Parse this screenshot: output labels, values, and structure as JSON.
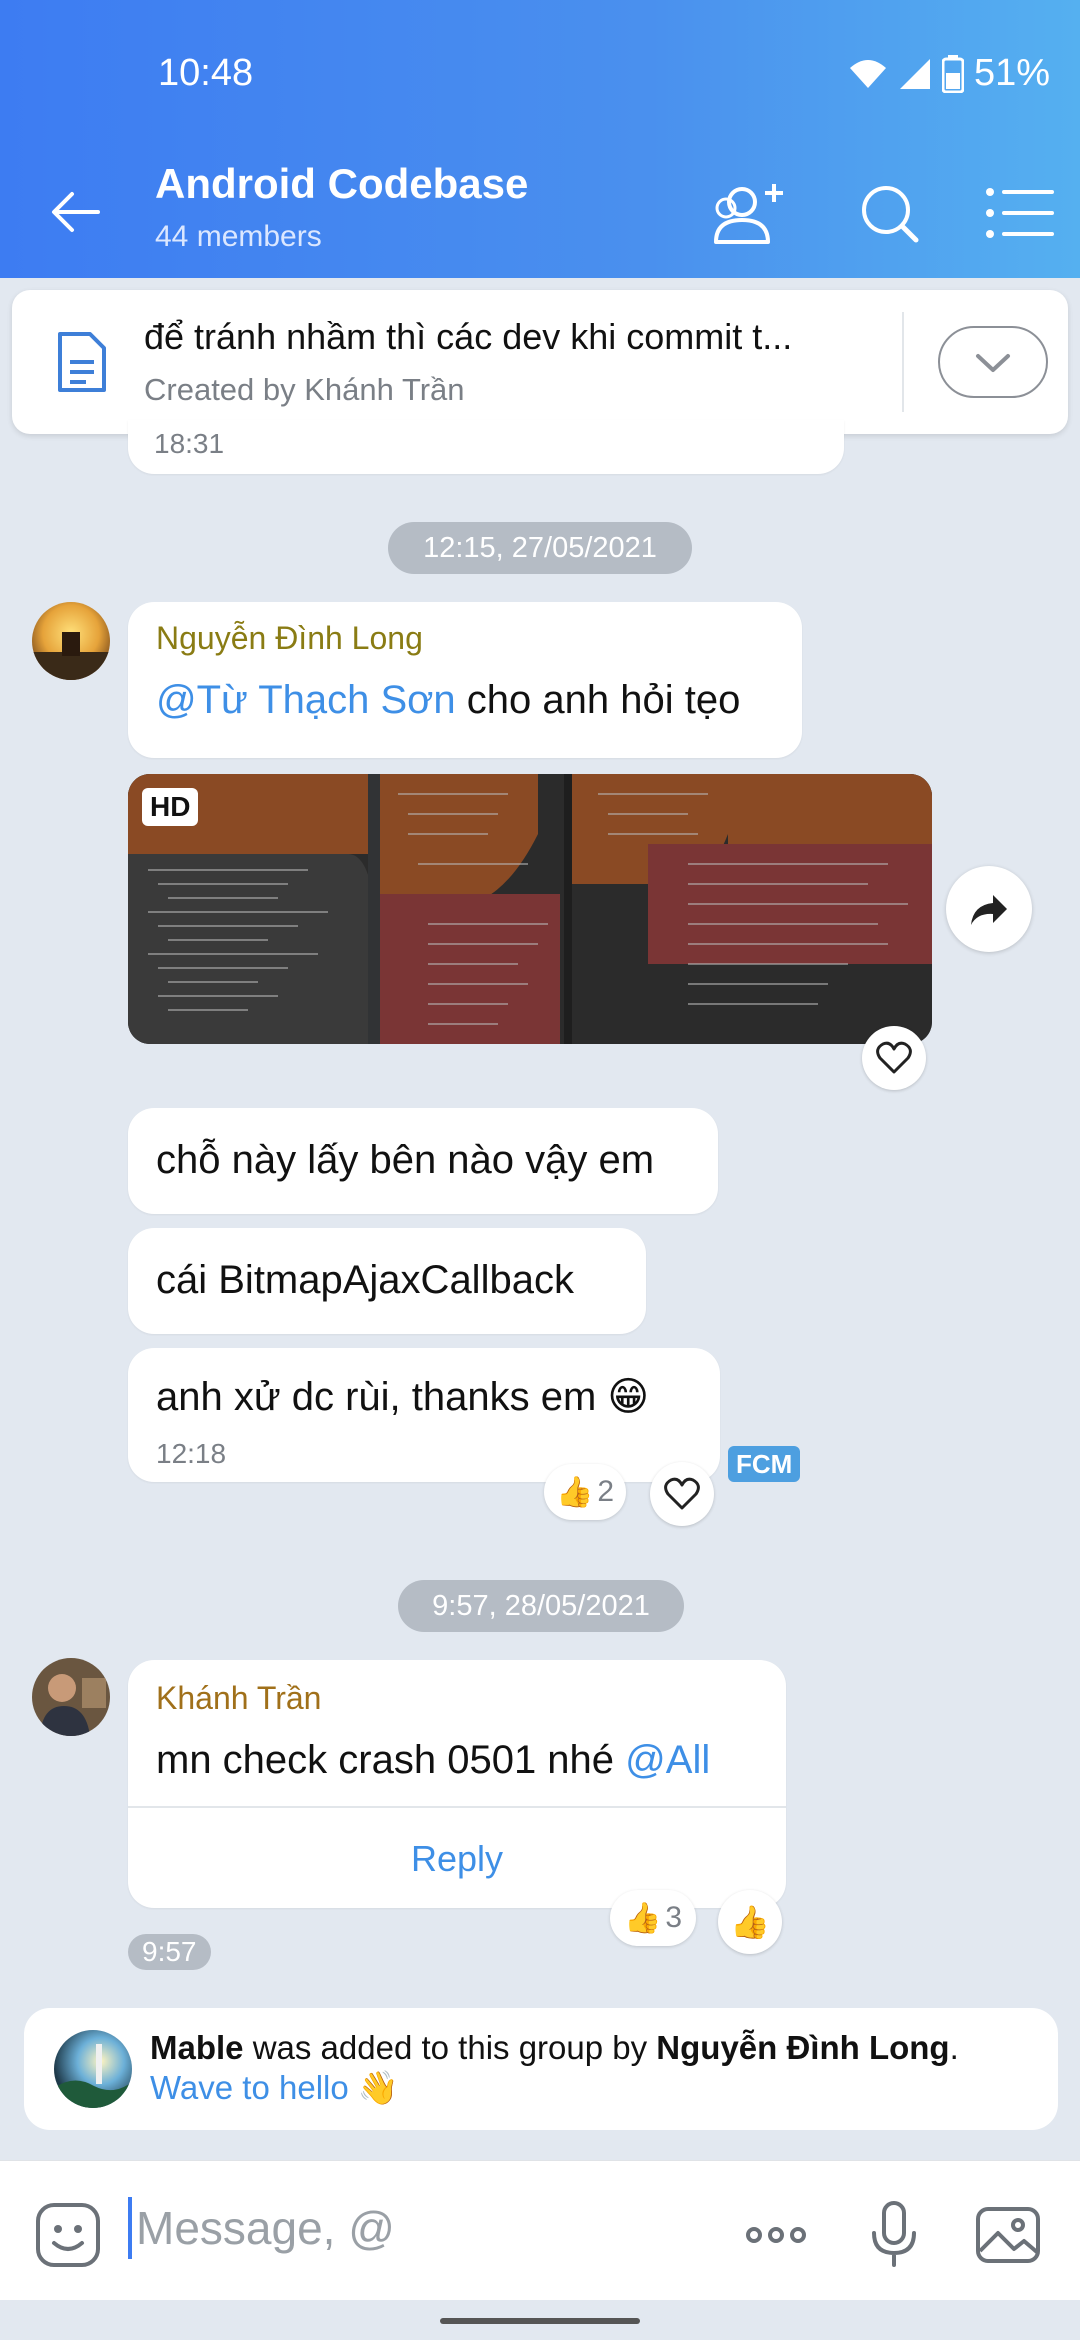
{
  "status": {
    "time": "10:48",
    "battery": "51%"
  },
  "header": {
    "title": "Android Codebase",
    "subtitle": "44 members"
  },
  "pinned": {
    "text": "để tránh nhầm thì các dev khi commit t...",
    "created_by": "Created by Khánh Trần"
  },
  "earlier_time": "18:31",
  "date1": "12:15, 27/05/2021",
  "msg1": {
    "sender": "Nguyễn Đình Long",
    "mention": "@Từ Thạch Sơn",
    "text": " cho anh hỏi tẹo",
    "image_badge": "HD"
  },
  "msg2": {
    "text": "chỗ này lấy bên nào vậy em"
  },
  "msg3": {
    "text": "cái BitmapAjaxCallback"
  },
  "msg4": {
    "text": "anh xử dc rùi, thanks em 😁",
    "time": "12:18",
    "like_count": "2",
    "badge": "FCM"
  },
  "date2": "9:57, 28/05/2021",
  "msg5": {
    "sender": "Khánh Trần",
    "text": "mn check crash 0501 nhé ",
    "mention": "@All",
    "reply": "Reply",
    "like_count": "3",
    "time": "9:57"
  },
  "system": {
    "name": "Mable",
    "middle": " was added to this group by ",
    "by": "Nguyễn Đình Long",
    "dot": ". ",
    "link": "Wave to hello",
    "emoji": " 👋"
  },
  "composer": {
    "placeholder": "Message, @"
  },
  "colors": {
    "header_start": "#3d7cf2",
    "header_end": "#55b0f0",
    "link": "#3e8fe6",
    "background": "#e2e8f0"
  }
}
